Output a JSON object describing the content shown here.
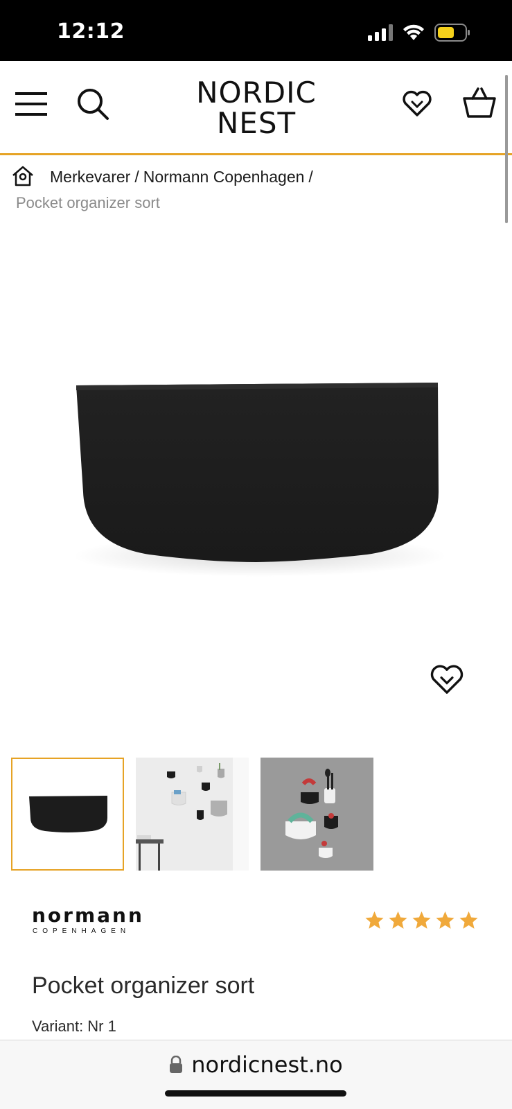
{
  "status_bar": {
    "time": "12:12"
  },
  "header": {
    "logo_line1": "NORDIC",
    "logo_line2": "NEST",
    "accent_color": "#e6a325"
  },
  "breadcrumb": {
    "items": [
      "Merkevarer",
      "Normann Copenhagen"
    ],
    "separator": "/",
    "current": "Pocket organizer sort"
  },
  "gallery": {
    "thumbnails": [
      "product-front",
      "lifestyle-wall-white",
      "lifestyle-wall-grey"
    ],
    "active_index": 0
  },
  "brand": {
    "name": "normann",
    "sub": "COPENHAGEN"
  },
  "rating": {
    "stars": 5,
    "max": 5,
    "color": "#f0a93b"
  },
  "product": {
    "title": "Pocket organizer sort",
    "variant": "Variant: Nr 1"
  },
  "browser": {
    "url": "nordicnest.no"
  }
}
